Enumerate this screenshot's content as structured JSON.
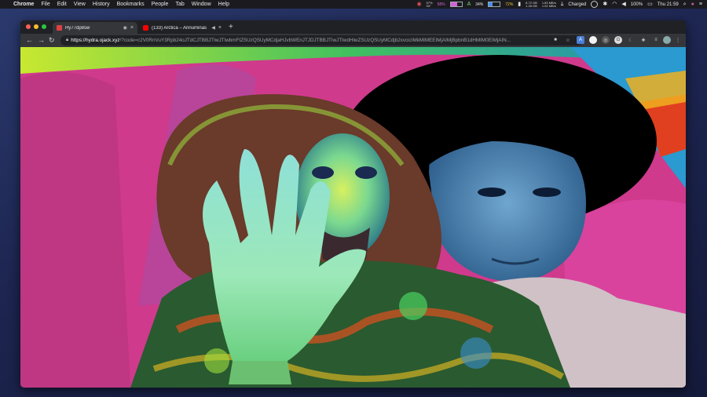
{
  "menubar": {
    "app": "Chrome",
    "items": [
      "File",
      "Edit",
      "View",
      "History",
      "Bookmarks",
      "People",
      "Tab",
      "Window",
      "Help"
    ],
    "stat_a_top": "97%",
    "stat_a_bot": "93°",
    "mem_pct": "58%",
    "mem_level": 0.58,
    "cpu_pct": "34%",
    "cpu_level": 0.34,
    "bat_pct": "72%",
    "disk_a_top": "8.72 GB",
    "disk_a_bot": "1.28 GB",
    "net_top": "1.83 MB/s",
    "net_bot": "1.02 MB/s",
    "charged": "Charged",
    "battery": "100%",
    "clock": "Thu 21:59"
  },
  "tabs": [
    {
      "title": "Hy77dp8sw",
      "active": true
    },
    {
      "title": "(133) Arctica – Annuminas",
      "active": false
    }
  ],
  "toolbar": {
    "host": "https://hydra.ojack.xyz",
    "path": "/?code=c2V0RnVuY3Rpb24oJTdCJTBBJTIwJTIwbmFtZSUzQSUyMCdjaHJvbWEnJTJDJTBBJTIwJTIwdHlwZSUzQSUyMCdjb2xvcicIMkMIMEEIMjAIMjBpbnB1dHMIM0EIMjAIN..."
  },
  "colors": {
    "mem_color": "#d860d8",
    "tab_icon_1": "#e04040",
    "tab_icon_2": "#ff0000"
  }
}
